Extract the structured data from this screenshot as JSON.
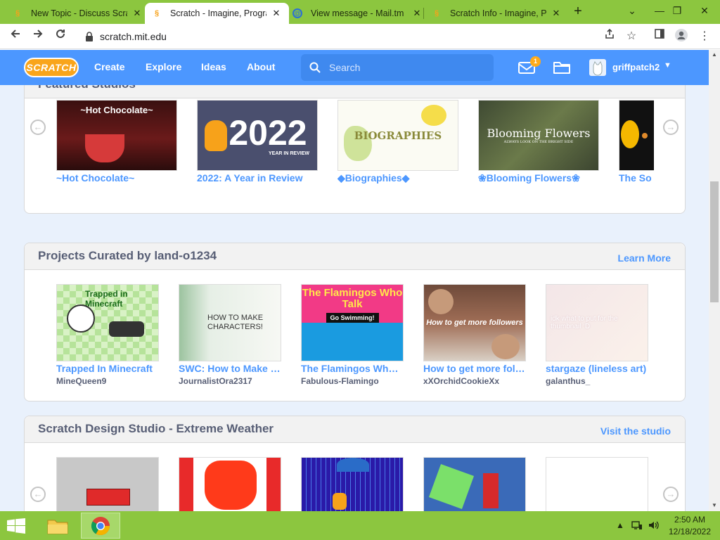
{
  "browser": {
    "tabs": [
      {
        "title": "New Topic - Discuss Scratch",
        "icon": "scratch-favicon"
      },
      {
        "title": "Scratch - Imagine, Program, Share",
        "icon": "scratch-favicon"
      },
      {
        "title": "View message - Mail.tm",
        "icon": "mail-favicon"
      },
      {
        "title": "Scratch Info - Imagine, Program, Share",
        "icon": "scratch-favicon"
      }
    ],
    "url": "scratch.mit.edu"
  },
  "nav": {
    "logo": "SCRATCH",
    "links": [
      "Create",
      "Explore",
      "Ideas",
      "About"
    ],
    "search_placeholder": "Search",
    "message_count": "1",
    "username": "griffpatch2"
  },
  "featured_studios": {
    "title": "Featured Studios",
    "items": [
      {
        "name": "~Hot Chocolate~",
        "thumb_text": "~Hot Chocolate~"
      },
      {
        "name": "2022: A Year in Review",
        "thumb_text": "2022",
        "thumb_sub": "YEAR IN REVIEW"
      },
      {
        "name": "◆Biographies◆",
        "thumb_text": "BIOGRAPHIES"
      },
      {
        "name": "❀Blooming Flowers❀",
        "thumb_text": "Blooming Flowers",
        "thumb_sub": "ALWAYS LOOK ON THE BRIGHT SIDE"
      },
      {
        "name": "The So",
        "thumb_text": ""
      }
    ]
  },
  "curated": {
    "title": "Projects Curated by land-o1234",
    "link": "Learn More",
    "items": [
      {
        "name": "Trapped In Minecraft",
        "author": "MineQueen9",
        "thumb_text": "Trapped in Minecraft"
      },
      {
        "name": "SWC: How to Make Characters",
        "author": "JournalistOra2317",
        "thumb_text": "HOW TO MAKE CHARACTERS!"
      },
      {
        "name": "The Flamingos Who Talk",
        "author": "Fabulous-Flamingo",
        "thumb_text": "The Flamingos Who Talk",
        "thumb_sub": "Go Swimming!"
      },
      {
        "name": "How to get more followers",
        "author": "xXOrchidCookieXx",
        "thumb_text": "How to get more followers"
      },
      {
        "name": "stargaze (lineless art)",
        "author": "galanthus_",
        "thumb_text": "idk what to put for the thumbnail :D"
      }
    ]
  },
  "design_studio": {
    "title": "Scratch Design Studio - Extreme Weather",
    "link": "Visit the studio"
  },
  "taskbar": {
    "time": "2:50 AM",
    "date": "12/18/2022"
  }
}
